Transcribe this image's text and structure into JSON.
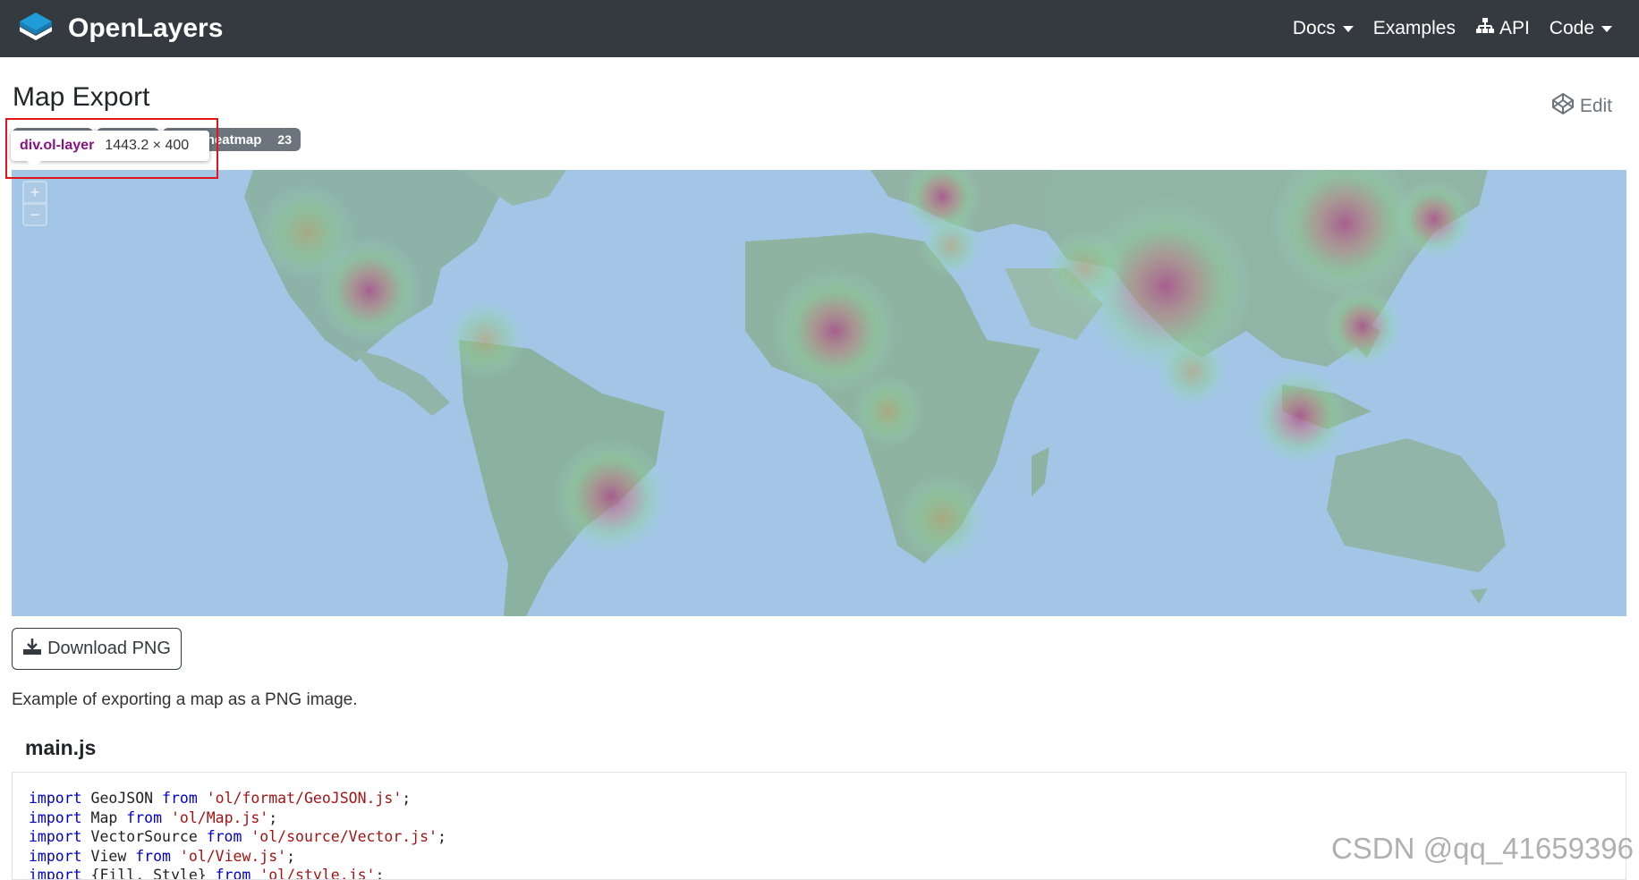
{
  "navbar": {
    "brand": "OpenLayers",
    "items": [
      {
        "label": "Docs",
        "dropdown": true
      },
      {
        "label": "Examples",
        "dropdown": false
      },
      {
        "label": "API",
        "dropdown": false,
        "icon": "sitemap-icon"
      },
      {
        "label": "Code",
        "dropdown": true
      }
    ]
  },
  "page": {
    "title": "Map Export",
    "edit_label": "Edit"
  },
  "tags": [
    {
      "label": "",
      "count": ""
    },
    {
      "label": "",
      "count": ""
    },
    {
      "label": "heatmap",
      "count": "23"
    }
  ],
  "inspector": {
    "selector": "div.ol-layer",
    "dimensions": "1443.2 × 400"
  },
  "map": {
    "zoom_in": "+",
    "zoom_out": "−",
    "ocean_color": "#a3c7e8"
  },
  "download": {
    "label": "Download PNG"
  },
  "description": "Example of exporting a map as a PNG image.",
  "code_file": {
    "title": "main.js",
    "lines": [
      [
        {
          "t": "import",
          "c": "kw"
        },
        {
          "t": " GeoJSON "
        },
        {
          "t": "from",
          "c": "kw"
        },
        {
          "t": " "
        },
        {
          "t": "'ol/format/GeoJSON.js'",
          "c": "str"
        },
        {
          "t": ";"
        }
      ],
      [
        {
          "t": "import",
          "c": "kw"
        },
        {
          "t": " Map "
        },
        {
          "t": "from",
          "c": "kw"
        },
        {
          "t": " "
        },
        {
          "t": "'ol/Map.js'",
          "c": "str"
        },
        {
          "t": ";"
        }
      ],
      [
        {
          "t": "import",
          "c": "kw"
        },
        {
          "t": " VectorSource "
        },
        {
          "t": "from",
          "c": "kw"
        },
        {
          "t": " "
        },
        {
          "t": "'ol/source/Vector.js'",
          "c": "str"
        },
        {
          "t": ";"
        }
      ],
      [
        {
          "t": "import",
          "c": "kw"
        },
        {
          "t": " View "
        },
        {
          "t": "from",
          "c": "kw"
        },
        {
          "t": " "
        },
        {
          "t": "'ol/View.js'",
          "c": "str"
        },
        {
          "t": ";"
        }
      ],
      [
        {
          "t": "import",
          "c": "kw"
        },
        {
          "t": " {Fill, Style} "
        },
        {
          "t": "from",
          "c": "kw"
        },
        {
          "t": " "
        },
        {
          "t": "'ol/style.js'",
          "c": "str"
        },
        {
          "t": ";"
        }
      ]
    ]
  },
  "watermark": "CSDN @qq_41659396"
}
